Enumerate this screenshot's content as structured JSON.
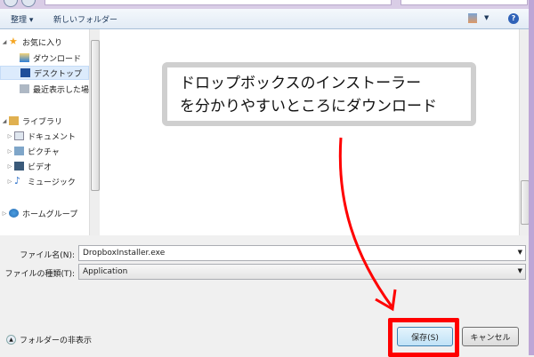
{
  "toolbar": {
    "organize": "整理 ▾",
    "new_folder": "新しいフォルダー"
  },
  "nav": {
    "favorites": "お気に入り",
    "downloads": "ダウンロード",
    "desktop": "デスクトップ",
    "recent": "最近表示した場所",
    "libraries": "ライブラリ",
    "documents": "ドキュメント",
    "pictures": "ピクチャ",
    "videos": "ビデオ",
    "music": "ミュージック",
    "homegroup": "ホームグループ"
  },
  "callout": {
    "line1": "ドロップボックスのインストーラー",
    "line2": "を分かりやすいところにダウンロード"
  },
  "form": {
    "filename_label": "ファイル名(N):",
    "filename_value": "DropboxInstaller.exe",
    "filetype_label": "ファイルの種類(T):",
    "filetype_value": "Application"
  },
  "footer": {
    "hide_folders": "フォルダーの非表示",
    "save": "保存(S)",
    "cancel": "キャンセル"
  },
  "colors": {
    "highlight": "#ff0000"
  }
}
